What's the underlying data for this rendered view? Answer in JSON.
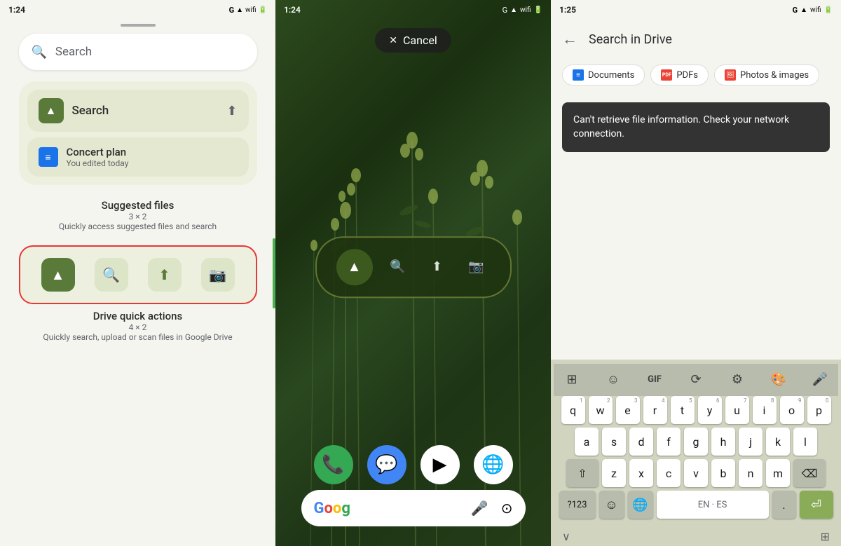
{
  "panel1": {
    "status": {
      "time": "1:24",
      "icons": [
        "g",
        "location",
        "signal",
        "wifi",
        "battery"
      ]
    },
    "search_placeholder": "Search",
    "widget": {
      "search_label": "Search",
      "upload_icon": "⬆",
      "file_name": "Concert plan",
      "file_subtitle": "You edited today"
    },
    "suggested_files": {
      "title": "Suggested files",
      "size": "3 × 2",
      "desc": "Quickly access suggested files and search"
    },
    "quick_actions": {
      "title": "Drive quick actions",
      "size": "4 × 2",
      "desc": "Quickly search, upload or scan files in Google Drive"
    }
  },
  "panel2": {
    "status": {
      "time": "1:24",
      "icons": [
        "g",
        "location",
        "signal",
        "wifi",
        "battery"
      ]
    },
    "cancel_label": "Cancel",
    "dock": {
      "phone": "📞",
      "messages": "💬",
      "play": "▶",
      "chrome": "🌐"
    }
  },
  "panel3": {
    "status": {
      "time": "1:25",
      "icons": [
        "g",
        "signal",
        "wifi",
        "battery"
      ]
    },
    "title": "Search in Drive",
    "filters": [
      {
        "label": "Documents",
        "icon": "≡",
        "color": "blue"
      },
      {
        "label": "PDFs",
        "icon": "PDF",
        "color": "red"
      },
      {
        "label": "Photos & images",
        "icon": "🖼",
        "color": "red"
      }
    ],
    "error_message": "Can't retrieve file information. Check your network connection.",
    "keyboard": {
      "toolbar_icons": [
        "⊞",
        "☺",
        "GIF",
        "translate",
        "⚙",
        "🎨",
        "🎤"
      ],
      "rows": [
        [
          {
            "key": "q",
            "sup": "1"
          },
          {
            "key": "w",
            "sup": "2"
          },
          {
            "key": "e",
            "sup": "3"
          },
          {
            "key": "r",
            "sup": "4"
          },
          {
            "key": "t",
            "sup": "5"
          },
          {
            "key": "y",
            "sup": "6"
          },
          {
            "key": "u",
            "sup": "7"
          },
          {
            "key": "i",
            "sup": "8"
          },
          {
            "key": "o",
            "sup": "9"
          },
          {
            "key": "p",
            "sup": "0"
          }
        ],
        [
          {
            "key": "a"
          },
          {
            "key": "s"
          },
          {
            "key": "d"
          },
          {
            "key": "f"
          },
          {
            "key": "g"
          },
          {
            "key": "h"
          },
          {
            "key": "j"
          },
          {
            "key": "k"
          },
          {
            "key": "l"
          }
        ],
        [
          {
            "key": "⇧",
            "type": "shift"
          },
          {
            "key": "z"
          },
          {
            "key": "x"
          },
          {
            "key": "c"
          },
          {
            "key": "v"
          },
          {
            "key": "b"
          },
          {
            "key": "n"
          },
          {
            "key": "m"
          },
          {
            "key": "⌫",
            "type": "backspace"
          }
        ],
        [
          {
            "key": "?123",
            "type": "numbers"
          },
          {
            "key": "☺",
            "type": "emoji"
          },
          {
            "key": "🌐",
            "type": "emoji"
          },
          {
            "key": "EN · ES",
            "type": "space"
          },
          {
            "key": ".",
            "type": "period"
          },
          {
            "key": "⏎",
            "type": "enter"
          }
        ]
      ],
      "bottom_left": "∨",
      "bottom_right": "⊞"
    }
  }
}
